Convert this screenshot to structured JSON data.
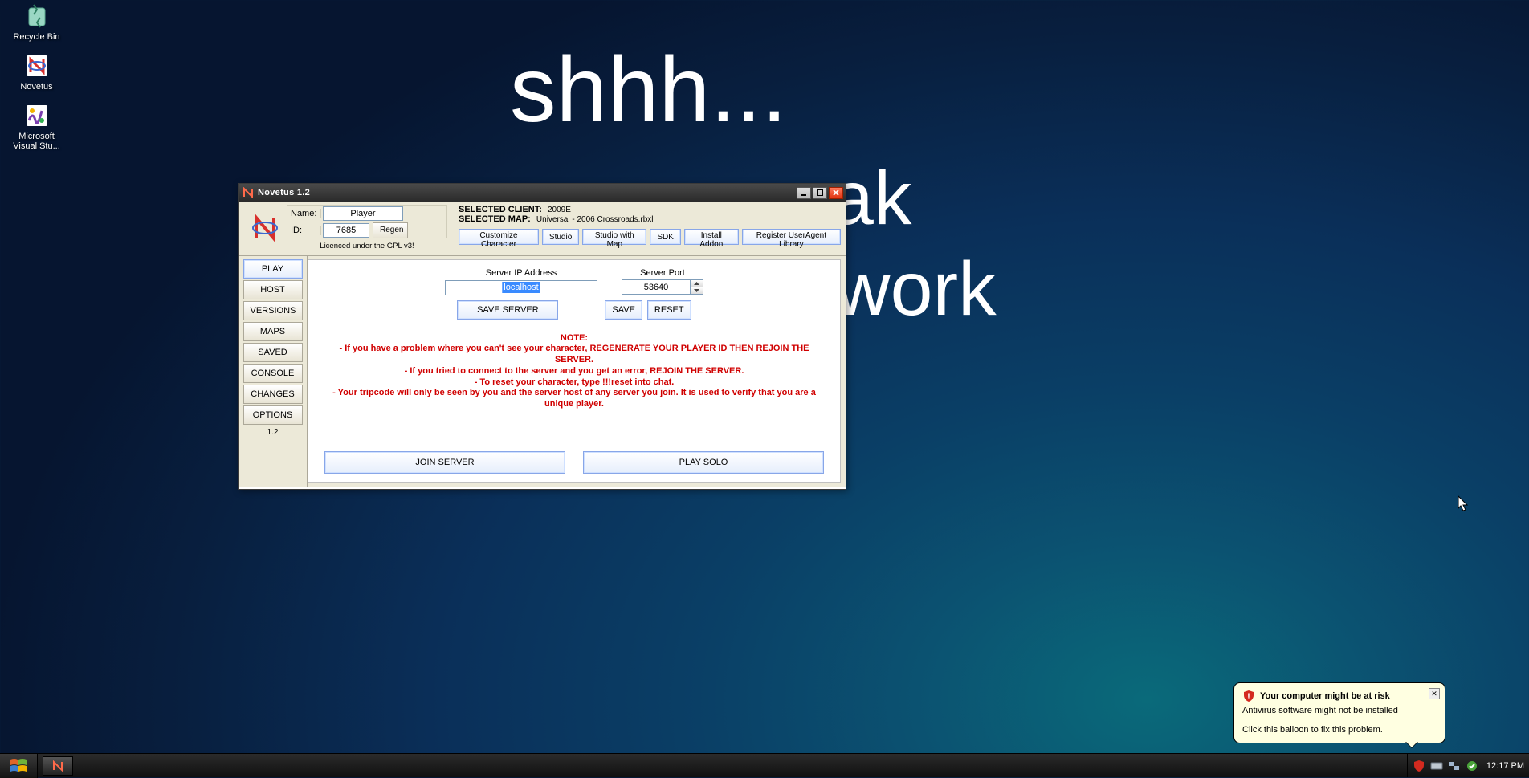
{
  "desktop": {
    "icons": [
      {
        "label": "Recycle Bin"
      },
      {
        "label": "Novetus"
      },
      {
        "label": "Microsoft Visual Stu..."
      }
    ]
  },
  "wallpaper": {
    "line1": "shhh...",
    "line2_fragment": "ak",
    "line3_fragment": "work"
  },
  "window": {
    "title": "Novetus 1.2",
    "name_label": "Name:",
    "name_value": "Player",
    "id_label": "ID:",
    "id_value": "7685",
    "regen": "Regen",
    "license": "Licenced under the GPL v3!",
    "selected_client_label": "SELECTED CLIENT:",
    "selected_client_value": "2009E",
    "selected_map_label": "SELECTED MAP:",
    "selected_map_value": "Universal - 2006 Crossroads.rbxl",
    "toolbar": {
      "customize": "Customize Character",
      "studio": "Studio",
      "studio_map": "Studio with Map",
      "sdk": "SDK",
      "install_addon": "Install Addon",
      "register_ua": "Register UserAgent Library"
    },
    "sidebar": {
      "play": "PLAY",
      "host": "HOST",
      "versions": "VERSIONS",
      "maps": "MAPS",
      "saved": "SAVED",
      "console": "CONSOLE",
      "changes": "CHANGES",
      "options": "OPTIONS",
      "version": "1.2"
    },
    "main": {
      "server_ip_label": "Server IP Address",
      "server_ip_value": "localhost",
      "server_port_label": "Server Port",
      "server_port_value": "53640",
      "save_server": "SAVE SERVER",
      "save": "SAVE",
      "reset": "RESET",
      "note_heading": "NOTE:",
      "note1": "- If you have a problem where you can't see your character, REGENERATE YOUR PLAYER ID THEN REJOIN THE SERVER.",
      "note2": "- If you tried to connect to the server and you get an error, REJOIN THE SERVER.",
      "note3": "- To reset your character, type !!!reset into chat.",
      "note4": "- Your tripcode will only be seen by you and the server host of any server you join. It is used to verify that you are a unique player.",
      "join_server": "JOIN SERVER",
      "play_solo": "PLAY SOLO"
    }
  },
  "balloon": {
    "title": "Your computer might be at risk",
    "line1": "Antivirus software might not be installed",
    "line2": "Click this balloon to fix this problem."
  },
  "taskbar": {
    "clock": "12:17 PM"
  }
}
